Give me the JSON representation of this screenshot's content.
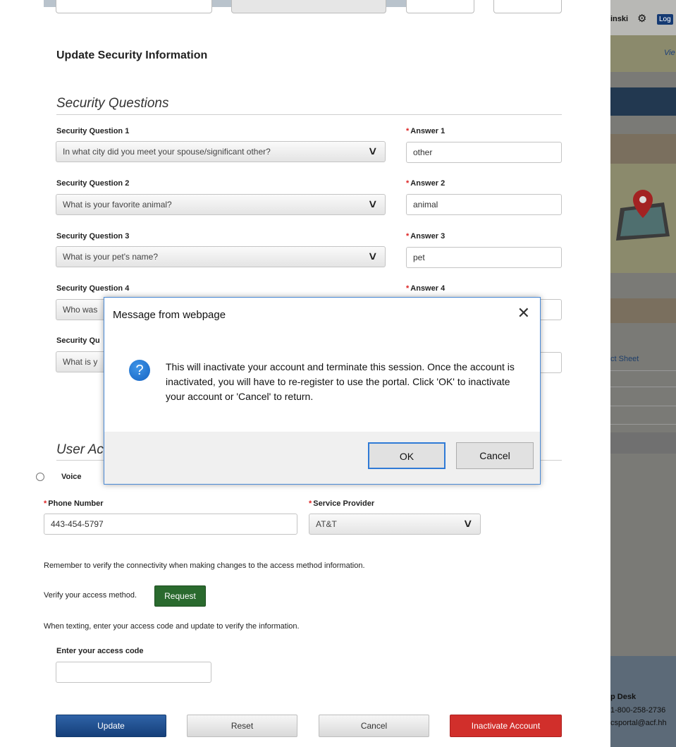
{
  "background": {
    "user_fragment": "inski",
    "log_label": "Log",
    "view_fragment": "Vie",
    "fact_fragment": "ct Sheet",
    "help_fragment": "p Desk",
    "phone_fragment": "1-800-258-2736",
    "mail_fragment": "csportal@acf.hh"
  },
  "page_title": "Update Security Information",
  "security": {
    "heading": "Security Questions",
    "q1_label": "Security Question 1",
    "q1_value": "In what city did you meet your spouse/significant other?",
    "a1_label": "Answer 1",
    "a1_value": "other",
    "q2_label": "Security Question 2",
    "q2_value": "What is your favorite animal?",
    "a2_label": "Answer 2",
    "a2_value": "animal",
    "q3_label": "Security Question 3",
    "q3_value": "What is your pet's name?",
    "a3_label": "Answer 3",
    "a3_value": "pet",
    "q4_label": "Security Question 4",
    "q4_value": "Who was",
    "a4_label": "Answer 4",
    "q5_label": "Security Qu",
    "q5_value": "What is y"
  },
  "access": {
    "heading": "User Ac",
    "voice_label": "Voice",
    "phone_label": "Phone Number",
    "phone_value": "443-454-5797",
    "provider_label": "Service Provider",
    "provider_value": "AT&T",
    "remember_text": "Remember to verify the connectivity when making changes to the access method information.",
    "verify_text": "Verify your access method.",
    "request_button": "Request",
    "texting_text": "When texting, enter your access code and update to verify the information.",
    "code_label": "Enter your access code",
    "code_value": ""
  },
  "buttons": {
    "update": "Update",
    "reset": "Reset",
    "cancel": "Cancel",
    "inactivate": "Inactivate Account"
  },
  "dialog": {
    "title": "Message from webpage",
    "close_glyph": "✕",
    "icon_glyph": "?",
    "message": "This will inactivate your account and terminate this session. Once the account is inactivated, you will have to re-register to use the portal. Click 'OK' to inactivate your account or 'Cancel' to return.",
    "ok": "OK",
    "cancel": "Cancel"
  },
  "colors": {
    "dialog_border": "#4a8ad6",
    "update_button": "#1f4f8f",
    "inactivate_button": "#d12f2b",
    "request_button": "#2a6a2e",
    "required_asterisk": "#dd2222"
  }
}
